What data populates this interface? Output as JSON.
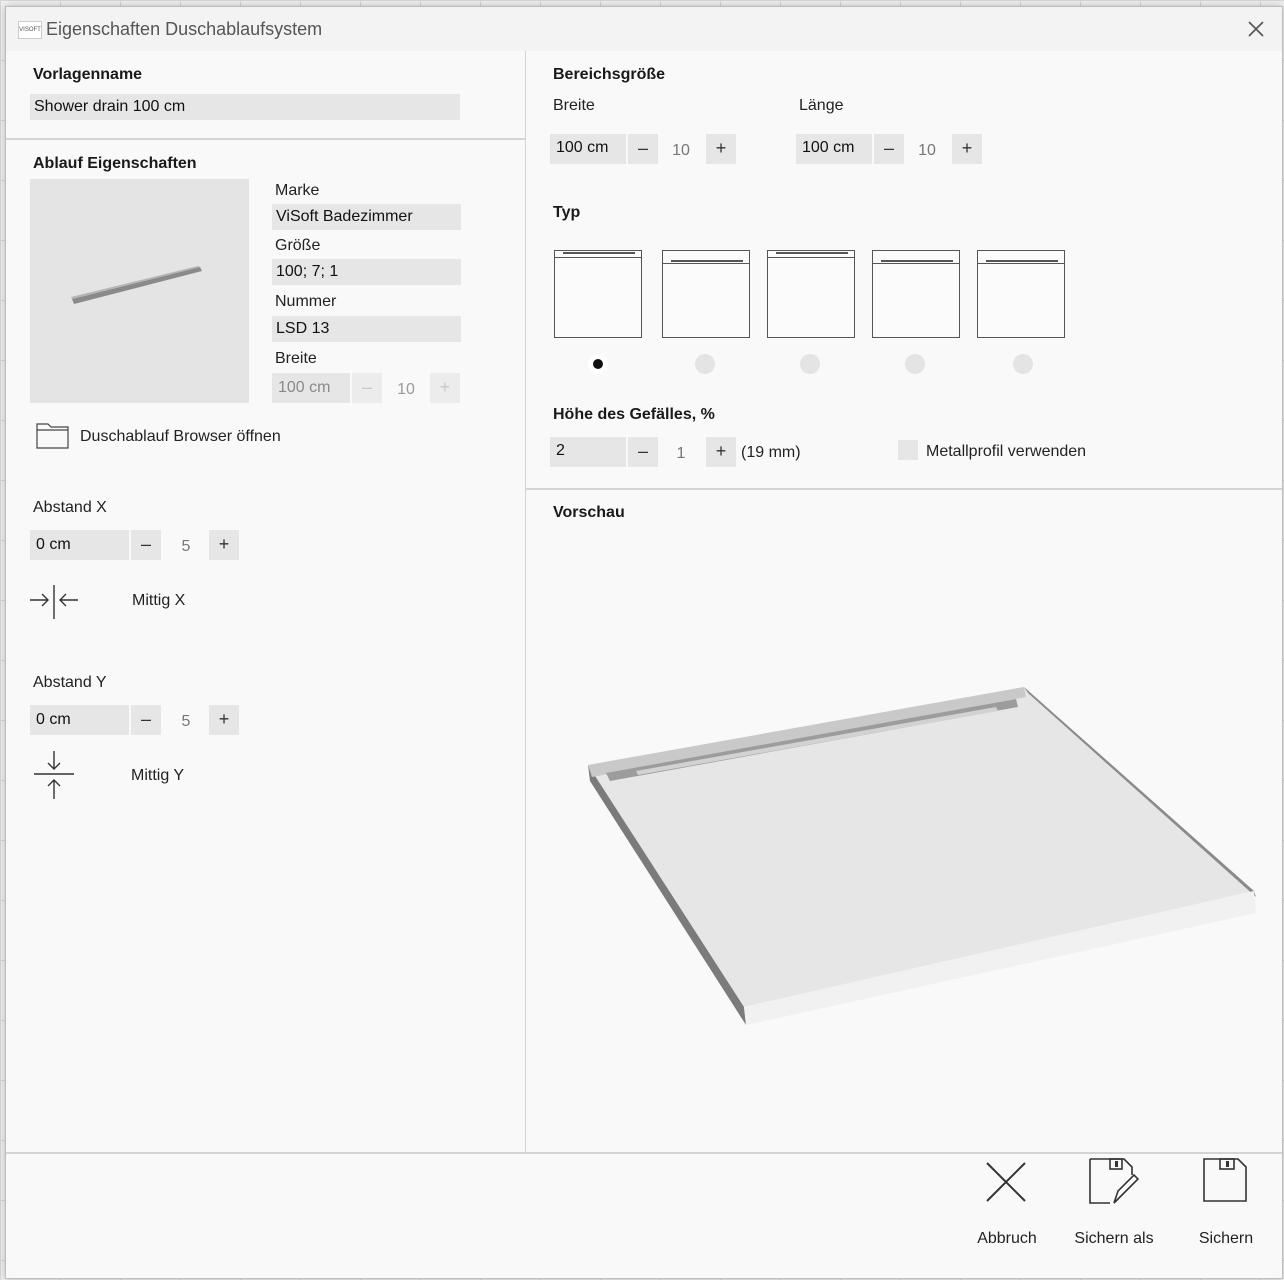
{
  "window": {
    "title": "Eigenschaften Duschablaufsystem",
    "logo_text": "VISOFT"
  },
  "template": {
    "label": "Vorlagenname",
    "value": "Shower drain  100 cm"
  },
  "drain": {
    "section_label": "Ablauf Eigenschaften",
    "brand_label": "Marke",
    "brand_value": "ViSoft Badezimmer",
    "size_label": "Größe",
    "size_value": "100; 7; 1",
    "number_label": "Nummer",
    "number_value": "LSD 13",
    "width_label": "Breite",
    "width_value": "100 cm",
    "width_step": "10",
    "browser_label": "Duschablauf Browser öffnen"
  },
  "distance_x": {
    "label": "Abstand X",
    "value": "0 cm",
    "step": "5",
    "center_label": "Mittig X"
  },
  "distance_y": {
    "label": "Abstand Y",
    "value": "0 cm",
    "step": "5",
    "center_label": "Mittig Y"
  },
  "area": {
    "label": "Bereichsgröße",
    "width_label": "Breite",
    "width_value": "100 cm",
    "width_step": "10",
    "length_label": "Länge",
    "length_value": "100 cm",
    "length_step": "10"
  },
  "type": {
    "label": "Typ",
    "options": [
      "type-1",
      "type-2",
      "type-3",
      "type-4",
      "type-5"
    ],
    "selected_index": 0
  },
  "slope": {
    "label": "Höhe des Gefälles, %",
    "value": "2",
    "step": "1",
    "mm_text": "(19 mm)",
    "metal_label": "Metallprofil verwenden",
    "metal_checked": false
  },
  "preview": {
    "label": "Vorschau"
  },
  "stepper": {
    "minus": "–",
    "plus": "+"
  },
  "actions": {
    "cancel": "Abbruch",
    "save_as": "Sichern als",
    "save": "Sichern"
  }
}
